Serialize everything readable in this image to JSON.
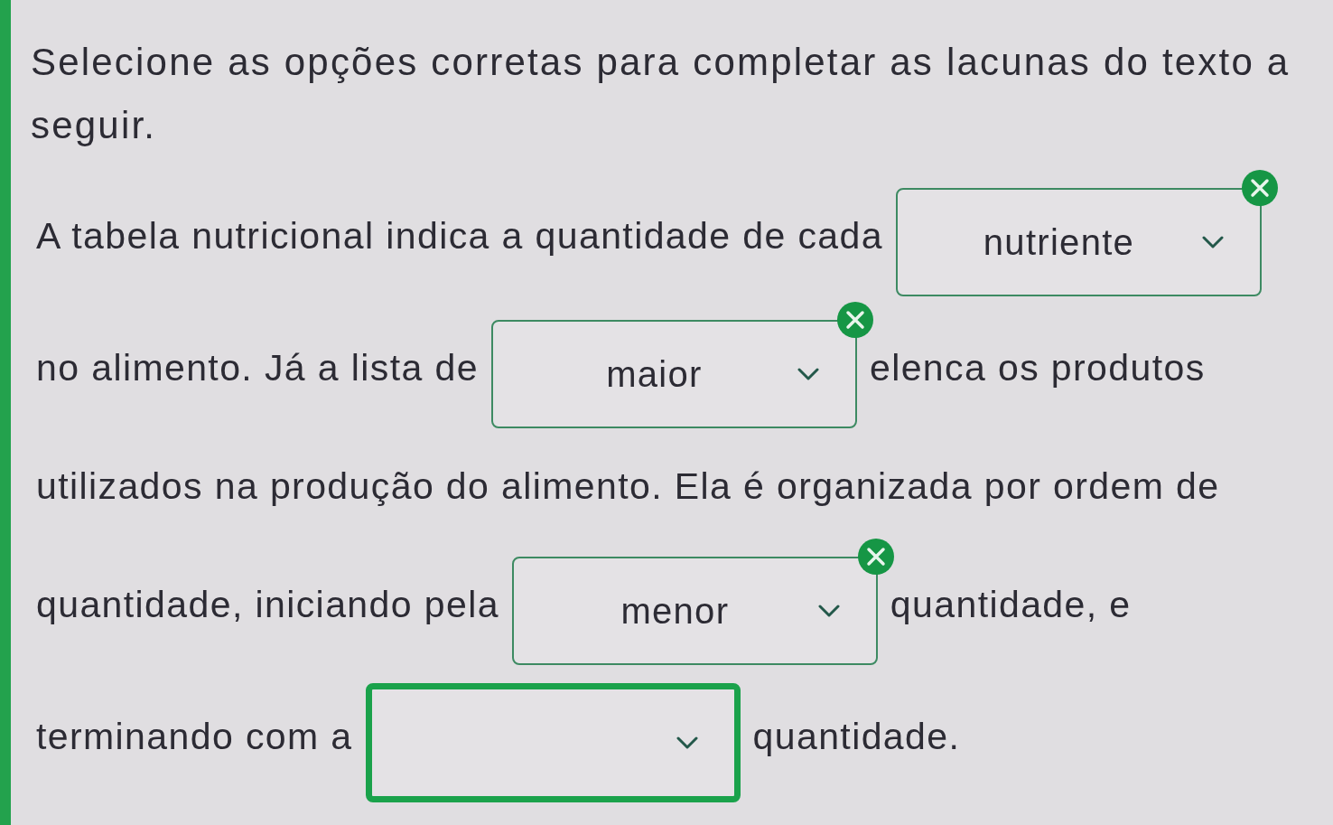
{
  "instruction": "Selecione as opções corretas para completar as lacunas do texto a seguir.",
  "passage": {
    "lines": [
      {
        "segments": [
          {
            "kind": "text",
            "text": "A tabela nutricional indica a quantidade de cada"
          },
          {
            "kind": "dropdown",
            "value": "nutriente",
            "focused": false
          }
        ]
      },
      {
        "segments": [
          {
            "kind": "text",
            "text": "no alimento. Já a lista de"
          },
          {
            "kind": "dropdown",
            "value": "maior",
            "focused": false
          },
          {
            "kind": "text",
            "text": "elenca os produtos"
          }
        ]
      },
      {
        "segments": [
          {
            "kind": "text",
            "text": "utilizados na produção do alimento. Ela é organizada por ordem de"
          }
        ]
      },
      {
        "segments": [
          {
            "kind": "text",
            "text": "quantidade, iniciando pela"
          },
          {
            "kind": "dropdown",
            "value": "menor",
            "focused": false
          },
          {
            "kind": "text",
            "text": "quantidade, e"
          }
        ]
      },
      {
        "segments": [
          {
            "kind": "text",
            "text": "terminando com a"
          },
          {
            "kind": "dropdown",
            "focused": true
          },
          {
            "kind": "text",
            "text": "quantidade."
          }
        ]
      }
    ]
  }
}
